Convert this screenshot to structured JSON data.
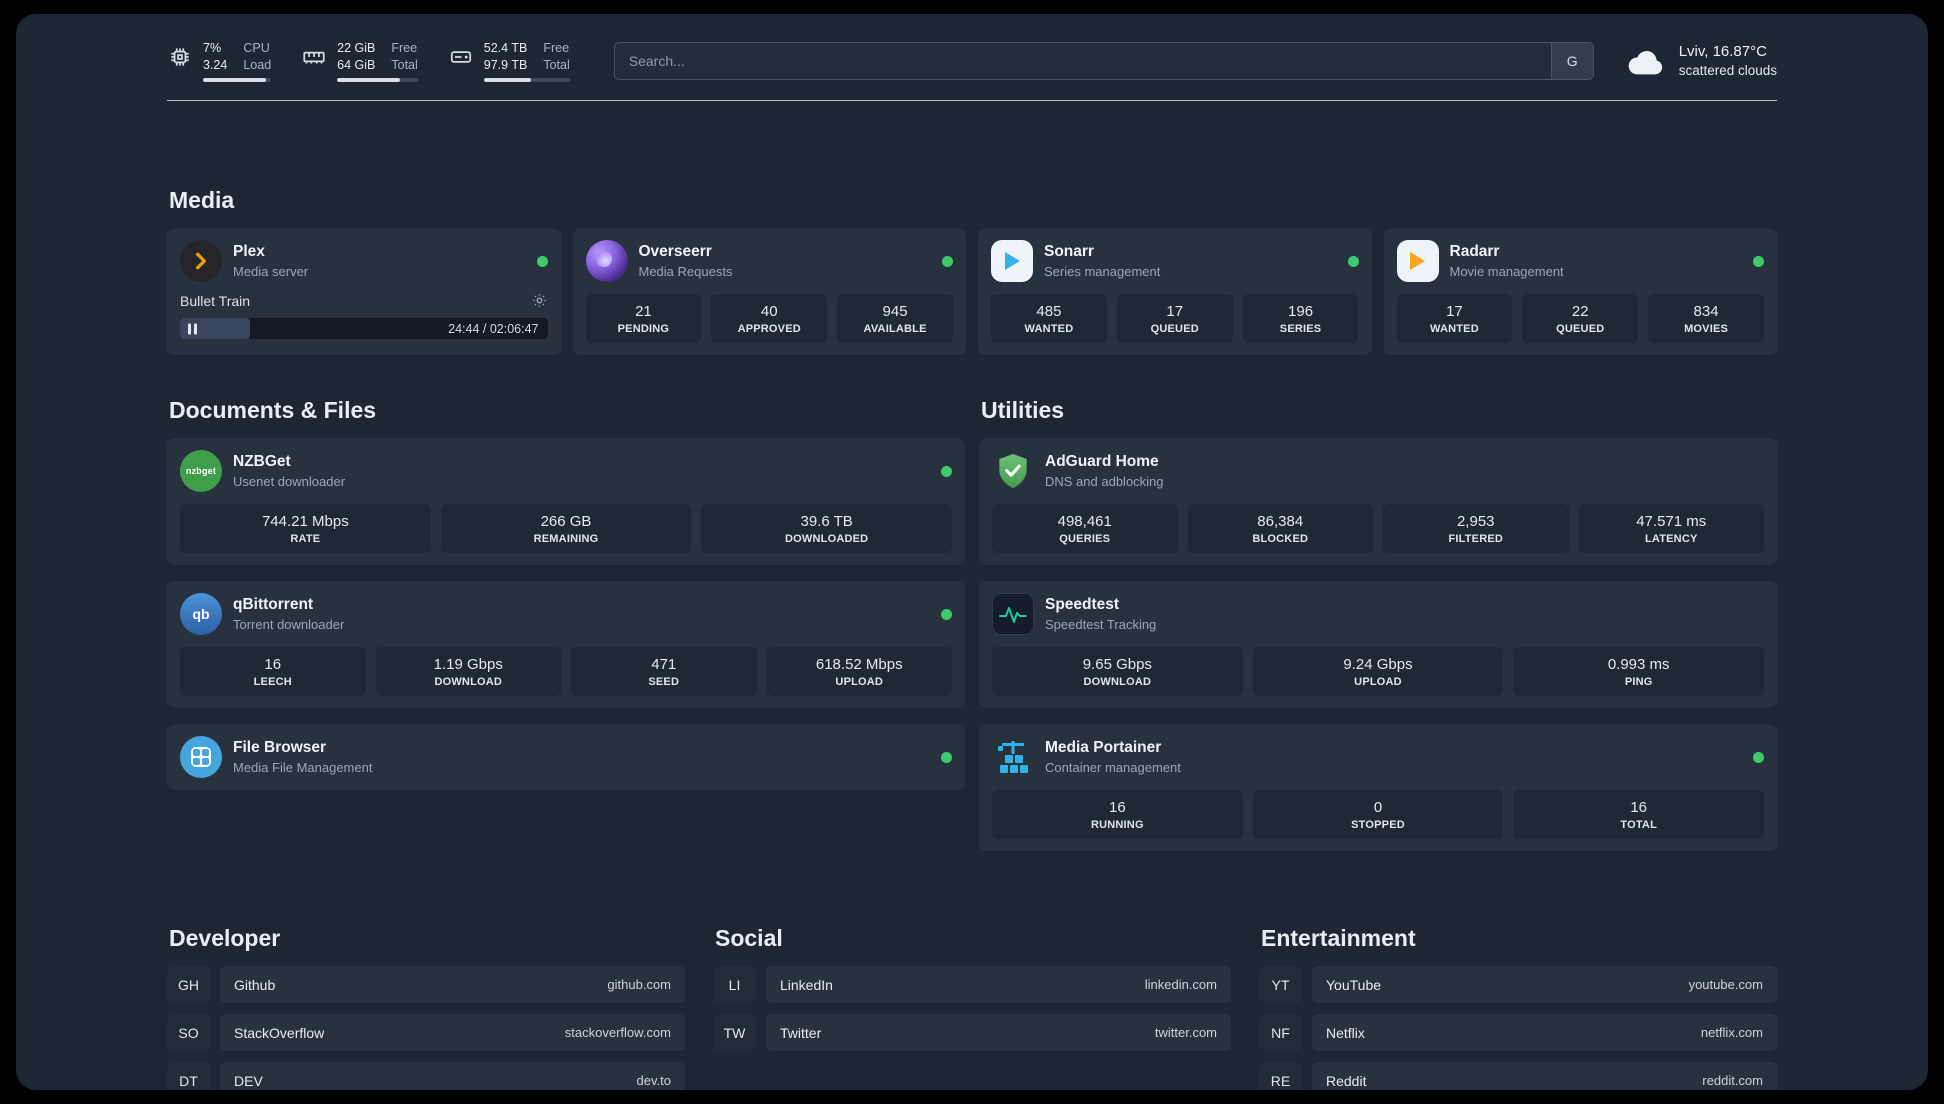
{
  "topbar": {
    "cpu": {
      "value_top": "7%",
      "value_bottom": "3.24",
      "label_top": "CPU",
      "label_bottom": "Load",
      "bar_percent": 93
    },
    "ram": {
      "value_top": "22 GiB",
      "value_bottom": "64 GiB",
      "label_top": "Free",
      "label_bottom": "Total",
      "bar_percent": 78
    },
    "disk": {
      "value_top": "52.4 TB",
      "value_bottom": "97.9 TB",
      "label_top": "Free",
      "label_bottom": "Total",
      "bar_percent": 55
    },
    "search": {
      "placeholder": "Search...",
      "key_hint": "G"
    },
    "weather": {
      "location": "Lviv, 16.87°C",
      "condition": "scattered clouds"
    }
  },
  "media": {
    "title": "Media",
    "plex": {
      "name": "Plex",
      "subtitle": "Media server",
      "track": "Bullet Train",
      "time": "24:44 / 02:06:47",
      "progress_percent": 19
    },
    "overseerr": {
      "name": "Overseerr",
      "subtitle": "Media Requests",
      "stats": [
        {
          "value": "21",
          "label": "PENDING"
        },
        {
          "value": "40",
          "label": "APPROVED"
        },
        {
          "value": "945",
          "label": "AVAILABLE"
        }
      ]
    },
    "sonarr": {
      "name": "Sonarr",
      "subtitle": "Series management",
      "stats": [
        {
          "value": "485",
          "label": "WANTED"
        },
        {
          "value": "17",
          "label": "QUEUED"
        },
        {
          "value": "196",
          "label": "SERIES"
        }
      ]
    },
    "radarr": {
      "name": "Radarr",
      "subtitle": "Movie management",
      "stats": [
        {
          "value": "17",
          "label": "WANTED"
        },
        {
          "value": "22",
          "label": "QUEUED"
        },
        {
          "value": "834",
          "label": "MOVIES"
        }
      ]
    }
  },
  "documents": {
    "title": "Documents & Files",
    "nzbget": {
      "name": "NZBGet",
      "subtitle": "Usenet downloader",
      "icon_text": "nzbget",
      "stats": [
        {
          "value": "744.21 Mbps",
          "label": "RATE"
        },
        {
          "value": "266 GB",
          "label": "REMAINING"
        },
        {
          "value": "39.6 TB",
          "label": "DOWNLOADED"
        }
      ]
    },
    "qbittorrent": {
      "name": "qBittorrent",
      "subtitle": "Torrent downloader",
      "icon_text": "qb",
      "stats": [
        {
          "value": "16",
          "label": "LEECH"
        },
        {
          "value": "1.19 Gbps",
          "label": "DOWNLOAD"
        },
        {
          "value": "471",
          "label": "SEED"
        },
        {
          "value": "618.52 Mbps",
          "label": "UPLOAD"
        }
      ]
    },
    "filebrowser": {
      "name": "File Browser",
      "subtitle": "Media File Management"
    }
  },
  "utilities": {
    "title": "Utilities",
    "adguard": {
      "name": "AdGuard Home",
      "subtitle": "DNS and adblocking",
      "stats": [
        {
          "value": "498,461",
          "label": "QUERIES"
        },
        {
          "value": "86,384",
          "label": "BLOCKED"
        },
        {
          "value": "2,953",
          "label": "FILTERED"
        },
        {
          "value": "47.571 ms",
          "label": "LATENCY"
        }
      ]
    },
    "speedtest": {
      "name": "Speedtest",
      "subtitle": "Speedtest Tracking",
      "stats": [
        {
          "value": "9.65 Gbps",
          "label": "DOWNLOAD"
        },
        {
          "value": "9.24 Gbps",
          "label": "UPLOAD"
        },
        {
          "value": "0.993 ms",
          "label": "PING"
        }
      ]
    },
    "portainer": {
      "name": "Media Portainer",
      "subtitle": "Container management",
      "stats": [
        {
          "value": "16",
          "label": "RUNNING"
        },
        {
          "value": "0",
          "label": "STOPPED"
        },
        {
          "value": "16",
          "label": "TOTAL"
        }
      ]
    }
  },
  "bookmarks": {
    "developer": {
      "title": "Developer",
      "items": [
        {
          "abbr": "GH",
          "name": "Github",
          "url": "github.com"
        },
        {
          "abbr": "SO",
          "name": "StackOverflow",
          "url": "stackoverflow.com"
        },
        {
          "abbr": "DT",
          "name": "DEV",
          "url": "dev.to"
        }
      ]
    },
    "social": {
      "title": "Social",
      "items": [
        {
          "abbr": "LI",
          "name": "LinkedIn",
          "url": "linkedin.com"
        },
        {
          "abbr": "TW",
          "name": "Twitter",
          "url": "twitter.com"
        }
      ]
    },
    "entertainment": {
      "title": "Entertainment",
      "items": [
        {
          "abbr": "YT",
          "name": "YouTube",
          "url": "youtube.com"
        },
        {
          "abbr": "NF",
          "name": "Netflix",
          "url": "netflix.com"
        },
        {
          "abbr": "RE",
          "name": "Reddit",
          "url": "reddit.com"
        }
      ]
    }
  }
}
